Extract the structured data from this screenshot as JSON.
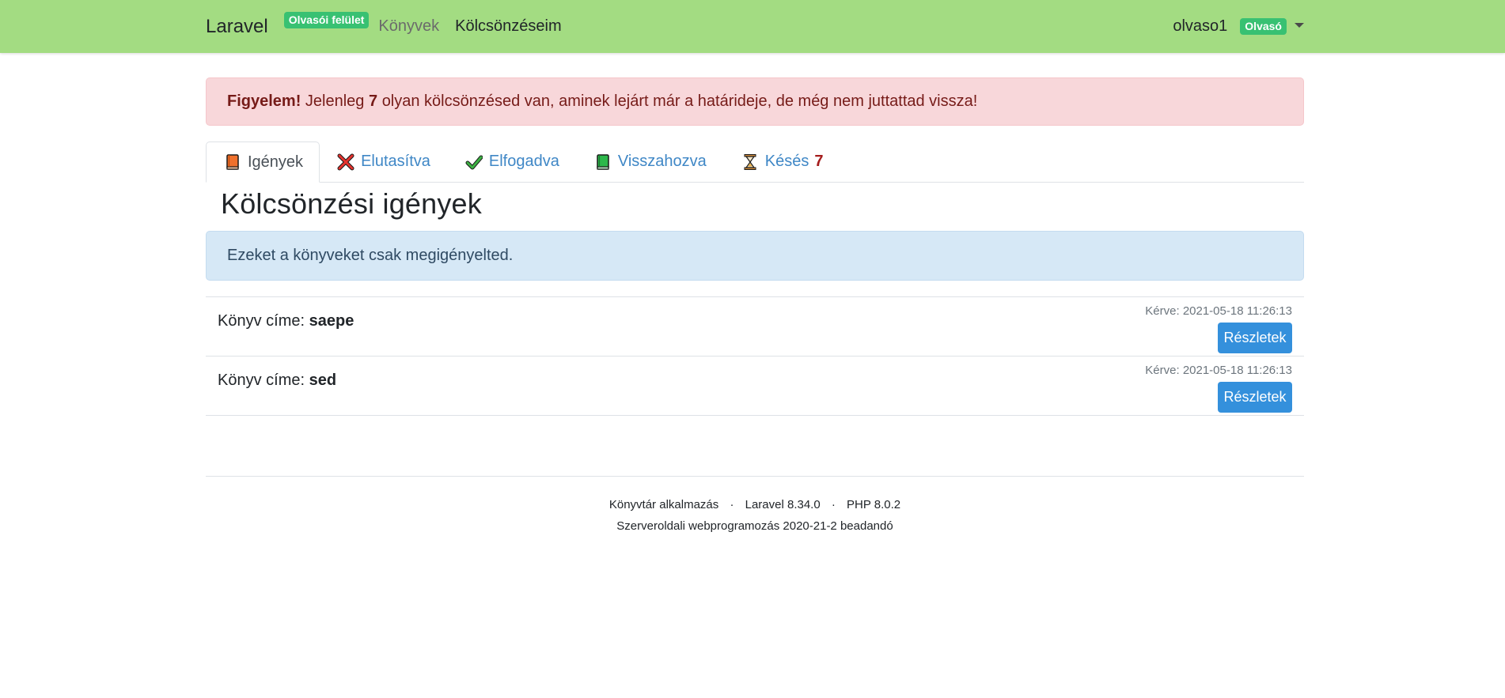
{
  "navbar": {
    "brand": "Laravel",
    "brand_badge": "Olvasói felület",
    "links": [
      {
        "label": "Könyvek"
      },
      {
        "label": "Kölcsönzéseim"
      }
    ],
    "username": "olvaso1",
    "role_badge": "Olvasó"
  },
  "alert": {
    "strong": "Figyelem!",
    "text_before": "Jelenleg",
    "count": "7",
    "text_after": "olyan kölcsönzésed van, aminek lejárt már a határideje, de még nem juttattad vissza!"
  },
  "tabs": [
    {
      "label": "Igények",
      "icon": "orange-book-icon",
      "active": true
    },
    {
      "label": "Elutasítva",
      "icon": "red-x-icon"
    },
    {
      "label": "Elfogadva",
      "icon": "green-check-icon"
    },
    {
      "label": "Visszahozva",
      "icon": "green-book-icon"
    },
    {
      "label": "Késés",
      "icon": "hourglass-icon",
      "count": "7"
    }
  ],
  "section": {
    "title": "Kölcsönzési igények",
    "info": "Ezeket a könyveket csak megigényelted."
  },
  "items": [
    {
      "title_label": "Könyv címe:",
      "title": "saepe",
      "requested": "Kérve: 2021-05-18 11:26:13",
      "button": "Részletek"
    },
    {
      "title_label": "Könyv címe:",
      "title": "sed",
      "requested": "Kérve: 2021-05-18 11:26:13",
      "button": "Részletek"
    }
  ],
  "footer": {
    "app": "Könyvtár alkalmazás",
    "sep": "·",
    "laravel": "Laravel 8.34.0",
    "php": "PHP 8.0.2",
    "course": "Szerveroldali webprogramozás 2020-21-2 beadandó"
  },
  "colors": {
    "navbar": "#a3dc82",
    "badge": "#38c172",
    "primary": "#3490dc",
    "danger_bg": "#f8d7da",
    "info_bg": "#d6e8f6"
  }
}
